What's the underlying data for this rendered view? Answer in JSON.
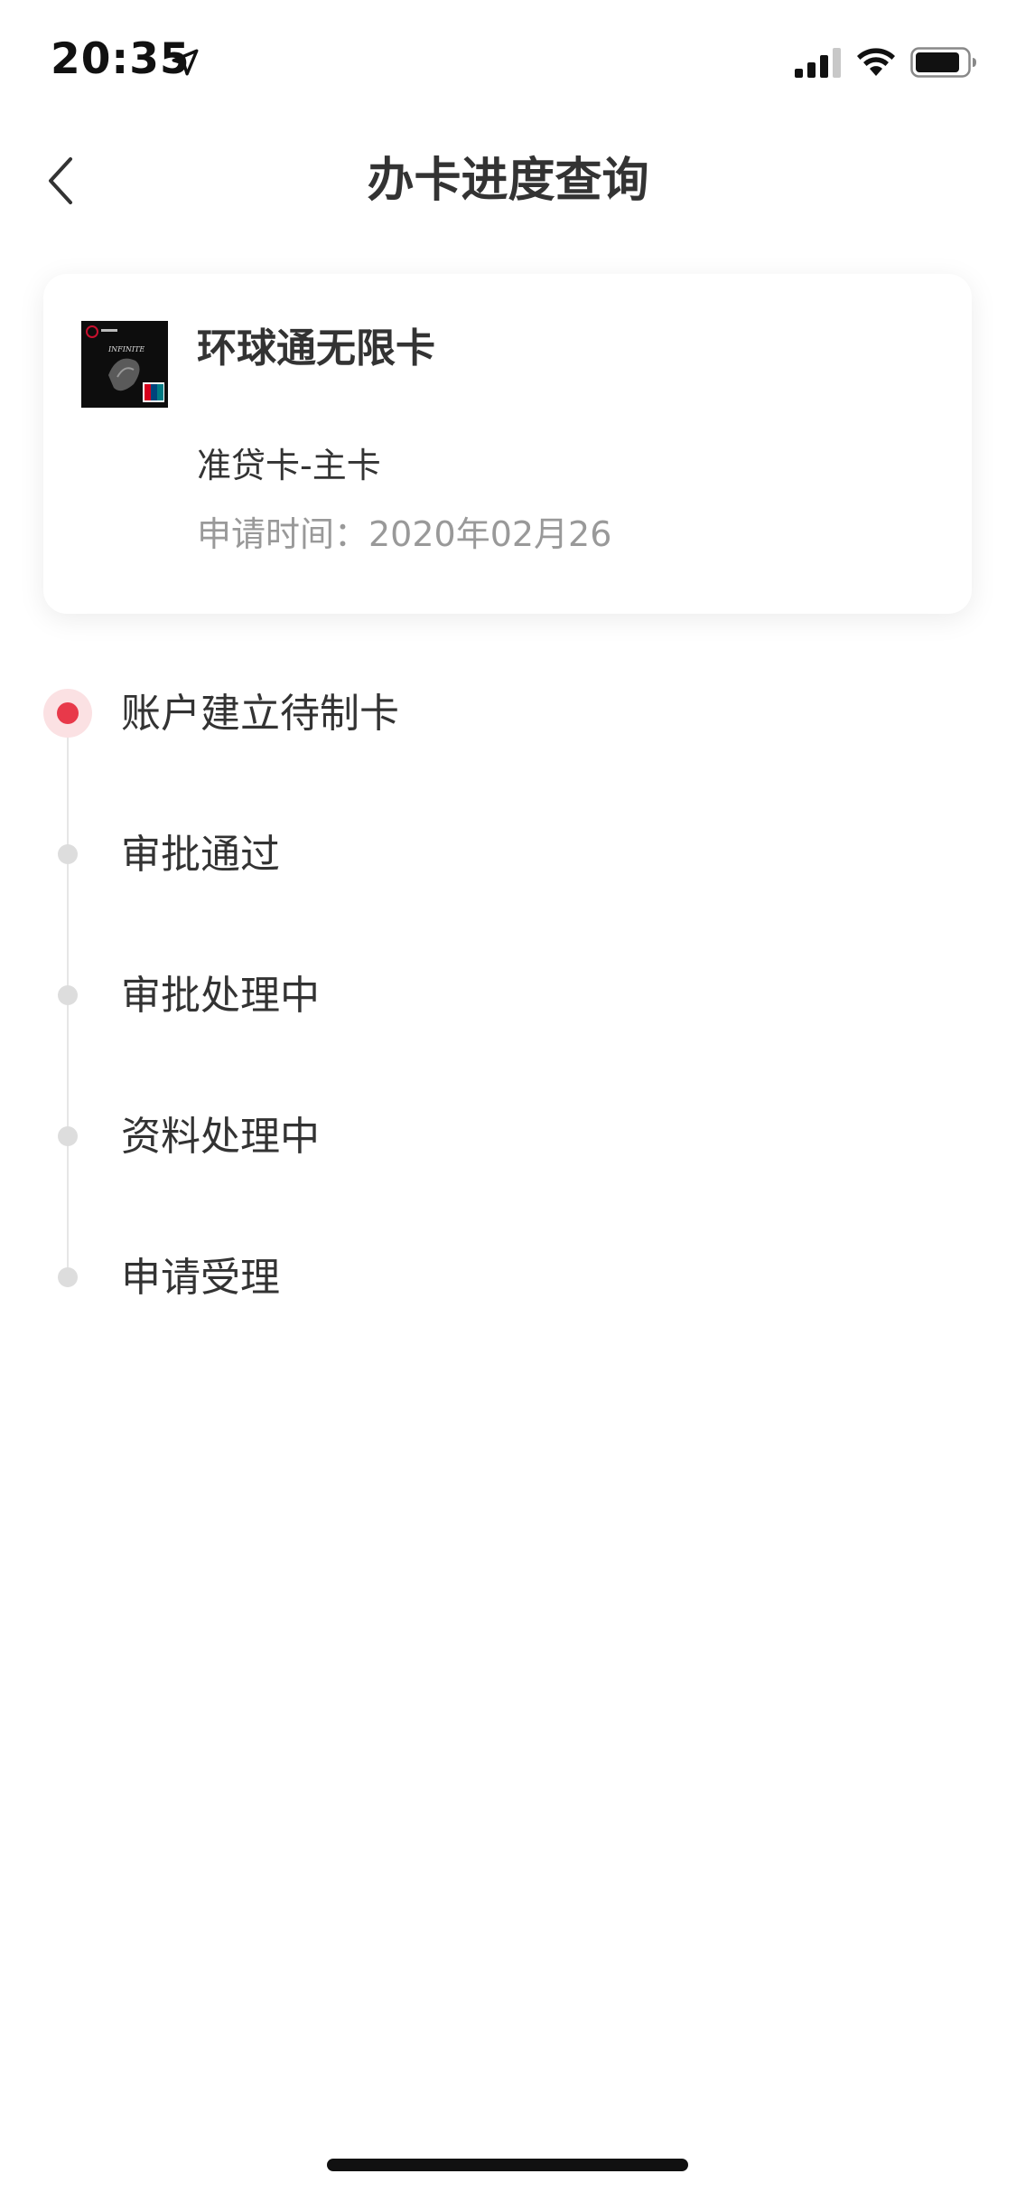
{
  "status_bar": {
    "time": "20:35"
  },
  "nav": {
    "title": "办卡进度查询"
  },
  "card": {
    "name": "环球通无限卡",
    "type": "准贷卡-主卡",
    "apply_time": "申请时间：2020年02月26",
    "image_text": "INFINITE"
  },
  "timeline": {
    "steps": [
      {
        "label": "账户建立待制卡",
        "status": "active"
      },
      {
        "label": "审批通过",
        "status": "done"
      },
      {
        "label": "审批处理中",
        "status": "done"
      },
      {
        "label": "资料处理中",
        "status": "done"
      },
      {
        "label": "申请受理",
        "status": "done"
      }
    ]
  },
  "colors": {
    "accent": "#e8394a",
    "accent_light": "#fbe1e3",
    "text_primary": "#333333",
    "text_secondary": "#999999",
    "dot_inactive": "#dddddd"
  }
}
